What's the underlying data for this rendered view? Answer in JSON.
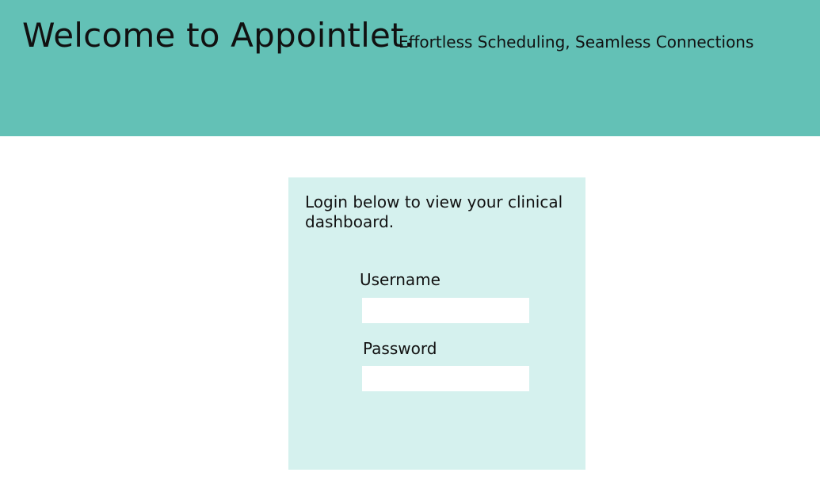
{
  "header": {
    "title": "Welcome to Appointlet.",
    "tagline": "Effortless Scheduling, Seamless Connections"
  },
  "login": {
    "intro": "Login below to view your clinical dashboard.",
    "username_label": "Username",
    "username_value": "",
    "password_label": "Password",
    "password_value": ""
  },
  "colors": {
    "header_bg": "#63c1b6",
    "card_bg": "#d5f1ee",
    "input_bg": "#ffffff"
  }
}
